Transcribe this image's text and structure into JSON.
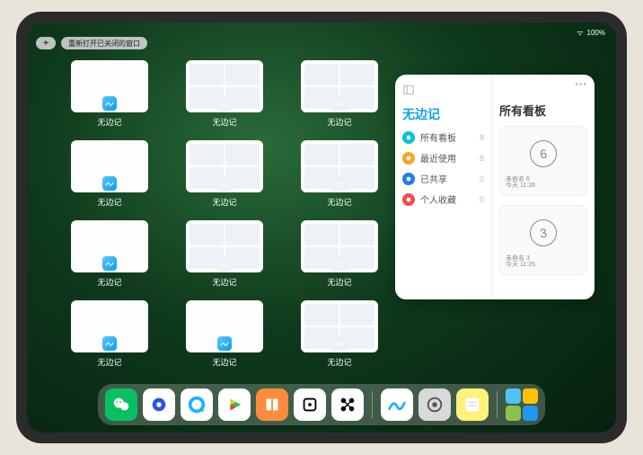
{
  "status": {
    "battery": "100%",
    "wifi": "●"
  },
  "topbar": {
    "plus": "+",
    "reopen_label": "重新打开已关闭的窗口"
  },
  "app_label": "无边记",
  "windows": [
    {
      "type": "blank"
    },
    {
      "type": "grid"
    },
    {
      "type": "grid"
    },
    {
      "type": "blank"
    },
    {
      "type": "grid"
    },
    {
      "type": "grid"
    },
    {
      "type": "blank"
    },
    {
      "type": "grid"
    },
    {
      "type": "grid"
    },
    {
      "type": "blank"
    },
    {
      "type": "blank"
    },
    {
      "type": "grid"
    }
  ],
  "panel": {
    "left_title": "无边记",
    "categories": [
      {
        "label": "所有看板",
        "color": "#0ac1d6",
        "count": 8
      },
      {
        "label": "最近使用",
        "color": "#f6a623",
        "count": 8
      },
      {
        "label": "已共享",
        "color": "#1f7ded",
        "count": 0
      },
      {
        "label": "个人收藏",
        "color": "#f14b4b",
        "count": 0
      }
    ],
    "right_title": "所有看板",
    "boards": [
      {
        "glyph": "6",
        "name": "未命名 6",
        "time": "今天 11:26"
      },
      {
        "glyph": "3",
        "name": "未命名 3",
        "time": "今天 11:25"
      }
    ]
  },
  "dock": [
    {
      "name": "wechat",
      "bg": "#07c160"
    },
    {
      "name": "qqbrowser",
      "bg": "#ffffff"
    },
    {
      "name": "browser-q",
      "bg": "#ffffff"
    },
    {
      "name": "play",
      "bg": "#ffffff"
    },
    {
      "name": "books",
      "bg": "#ff8b3d"
    },
    {
      "name": "dice",
      "bg": "#ffffff"
    },
    {
      "name": "connect",
      "bg": "#ffffff"
    },
    {
      "name": "freeform",
      "bg": "#ffffff"
    },
    {
      "name": "settings",
      "bg": "#d9d9d9"
    },
    {
      "name": "notes",
      "bg": "#fff27a"
    }
  ]
}
